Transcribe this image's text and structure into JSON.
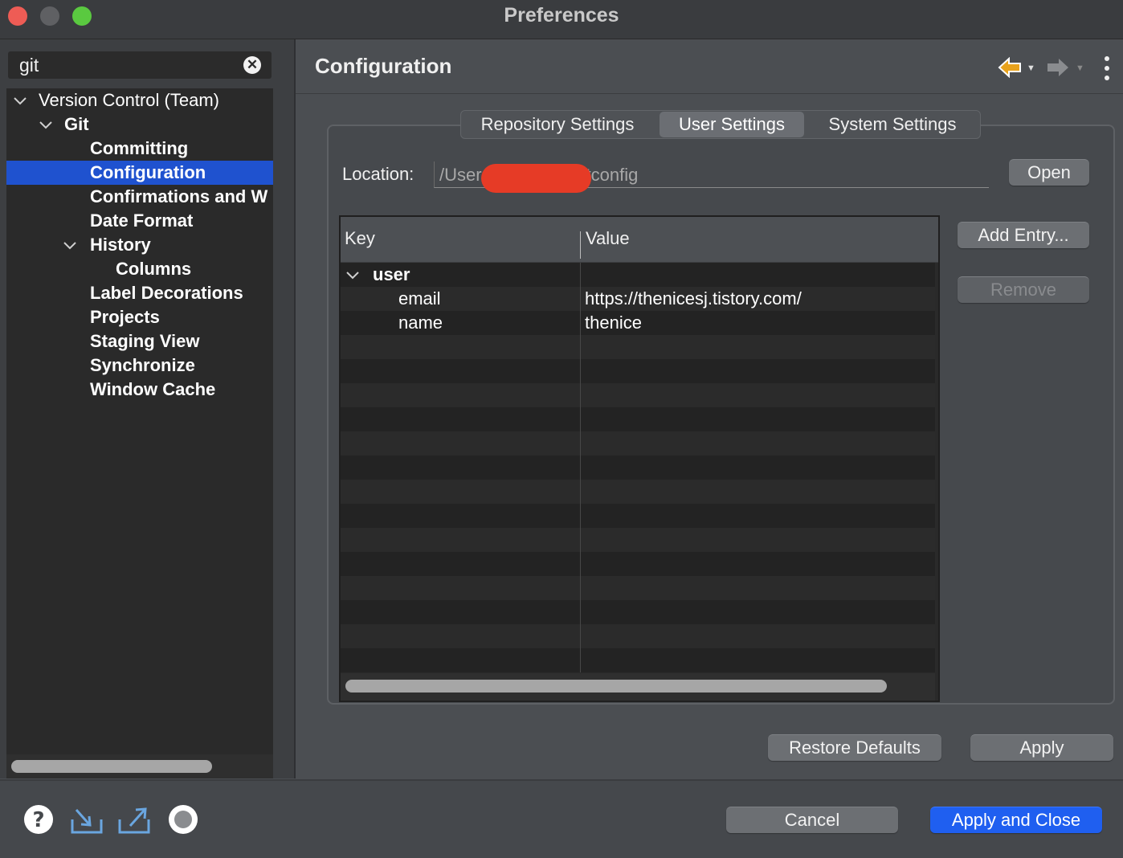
{
  "window": {
    "title": "Preferences",
    "traffic_lights": {
      "close": "#ee5c55",
      "minimize": "#5f6063",
      "zoom": "#5ac940"
    }
  },
  "sidebar": {
    "search": {
      "value": "git",
      "clear_icon": "clear-search-icon"
    },
    "tree": [
      {
        "label": "Version Control (Team)",
        "level": 0,
        "expanded": true,
        "bold": false
      },
      {
        "label": "Git",
        "level": 1,
        "expanded": true,
        "bold": true
      },
      {
        "label": "Committing",
        "level": 2,
        "bold": true
      },
      {
        "label": "Configuration",
        "level": 2,
        "bold": true,
        "selected": true
      },
      {
        "label": "Confirmations and W",
        "level": 2,
        "bold": true
      },
      {
        "label": "Date Format",
        "level": 2,
        "bold": true
      },
      {
        "label": "History",
        "level": 2,
        "expanded": true,
        "bold": true
      },
      {
        "label": "Columns",
        "level": 3,
        "bold": true
      },
      {
        "label": "Label Decorations",
        "level": 2,
        "bold": true
      },
      {
        "label": "Projects",
        "level": 2,
        "bold": true
      },
      {
        "label": "Staging View",
        "level": 2,
        "bold": true
      },
      {
        "label": "Synchronize",
        "level": 2,
        "bold": true
      },
      {
        "label": "Window Cache",
        "level": 2,
        "bold": true
      }
    ],
    "selection_color": "#1f52cf"
  },
  "main": {
    "title": "Configuration",
    "tabs": [
      {
        "label": "Repository Settings",
        "active": false
      },
      {
        "label": "User Settings",
        "active": true
      },
      {
        "label": "System Settings",
        "active": false
      }
    ],
    "location": {
      "label": "Location:",
      "value_prefix": "/User",
      "value_suffix": "tconfig",
      "redaction_color": "#e63b26"
    },
    "open_button": "Open",
    "add_entry_button": "Add Entry...",
    "remove_button": "Remove",
    "table": {
      "columns": [
        "Key",
        "Value"
      ],
      "rows": [
        {
          "key": "user",
          "value": "",
          "group": true
        },
        {
          "key": "email",
          "value": "https://thenicesj.tistory.com/"
        },
        {
          "key": "name",
          "value": "thenice"
        }
      ]
    },
    "restore_defaults_button": "Restore Defaults",
    "apply_button": "Apply"
  },
  "footer": {
    "icons": [
      "help-icon",
      "import-icon",
      "export-icon",
      "record-icon"
    ],
    "cancel_button": "Cancel",
    "apply_close_button": "Apply and Close",
    "primary_color": "#1f5ff0"
  }
}
